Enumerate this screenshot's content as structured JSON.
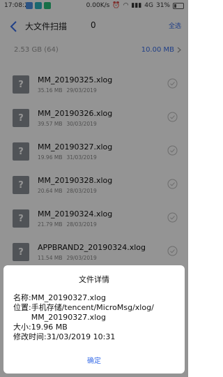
{
  "status_bar": {
    "time": "17:08:25",
    "speed": "0.00K/s",
    "network": "4G",
    "battery": "31%"
  },
  "header": {
    "title": "大文件扫描",
    "count": "0",
    "select_all": "全选"
  },
  "summary": {
    "total": "2.53 GB (64)",
    "size_filter": "10.00 MB"
  },
  "files": [
    {
      "name": "MM_20190325.xlog",
      "size": "35.16 MB",
      "date": "29/03/2019"
    },
    {
      "name": "MM_20190326.xlog",
      "size": "39.57 MB",
      "date": "30/03/2019"
    },
    {
      "name": "MM_20190327.xlog",
      "size": "19.96 MB",
      "date": "31/03/2019"
    },
    {
      "name": "MM_20190328.xlog",
      "size": "20.64 MB",
      "date": "28/03/2019"
    },
    {
      "name": "MM_20190324.xlog",
      "size": "21.79 MB",
      "date": "28/03/2019"
    },
    {
      "name": "APPBRAND2_20190324.xlog",
      "size": "11.54 MB",
      "date": "29/03/2019"
    }
  ],
  "file_icon_glyph": "?",
  "dialog": {
    "title": "文件详情",
    "name_label": "名称:",
    "name_value": "MM_20190327.xlog",
    "location_label": "位置:",
    "location_value": "手机存储/tencent/MicroMsg/xlog/\nMM_20190327.xlog",
    "size_label": "大小:",
    "size_value": "19.96 MB",
    "modified_label": "修改时间:",
    "modified_value": "31/03/2019 10:31",
    "confirm": "确定"
  },
  "colors": {
    "accent": "#3a6ee8",
    "file_icon": "#8a8f97"
  }
}
